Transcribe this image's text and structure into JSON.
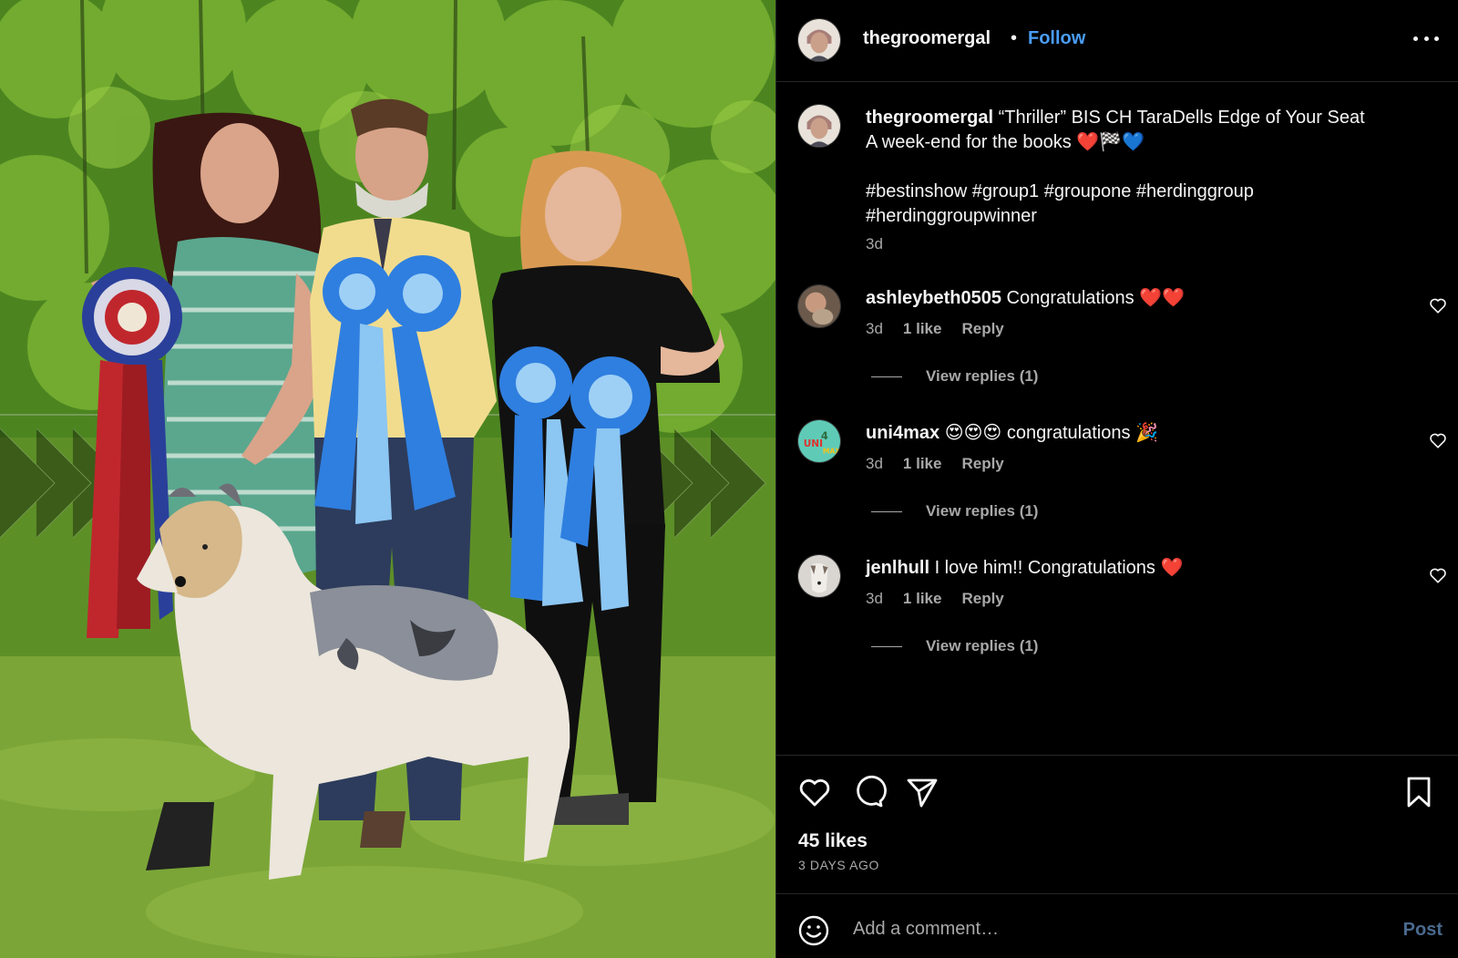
{
  "photo": {
    "description_icon": "photo-image",
    "colors": {
      "grass": "#6f9b2c",
      "foliage": "#4f8a22",
      "sky_leaf": "#8cc23c"
    }
  },
  "header": {
    "username": "thegroomergal",
    "separator": "•",
    "follow_label": "Follow",
    "more_icon": "more-horizontal-icon"
  },
  "caption": {
    "username": "thegroomergal",
    "line1": "“Thriller” BIS CH TaraDells Edge of Your Seat",
    "line2": "A week-end for the books ❤️🏁💙",
    "hashtags_line1": "#bestinshow #group1 #groupone #herdinggroup",
    "hashtags_line2": "#herdinggroupwinner",
    "time": "3d"
  },
  "comments": [
    {
      "username": "ashleybeth0505",
      "text": "Congratulations ❤️❤️",
      "time": "3d",
      "likes": "1 like",
      "reply_label": "Reply",
      "view_replies": "View replies (1)"
    },
    {
      "username": "uni4max",
      "text": "😍😍😍 congratulations 🎉",
      "time": "3d",
      "likes": "1 like",
      "reply_label": "Reply",
      "view_replies": "View replies (1)"
    },
    {
      "username": "jenlhull",
      "text": "I love him!! Congratulations ❤️",
      "time": "3d",
      "likes": "1 like",
      "reply_label": "Reply",
      "view_replies": "View replies (1)"
    }
  ],
  "actions": {
    "like_icon": "heart-icon",
    "comment_icon": "comment-icon",
    "share_icon": "send-icon",
    "save_icon": "bookmark-icon",
    "likes_count": "45 likes",
    "posted_ago": "3 DAYS AGO"
  },
  "comment_bar": {
    "placeholder": "Add a comment…",
    "post_label": "Post",
    "emoji_icon": "smiley-icon"
  },
  "colors": {
    "background": "#000000",
    "text": "#f5f5f5",
    "secondary_text": "#a8a8a8",
    "follow_blue": "#4a9df8",
    "divider": "#262626"
  }
}
